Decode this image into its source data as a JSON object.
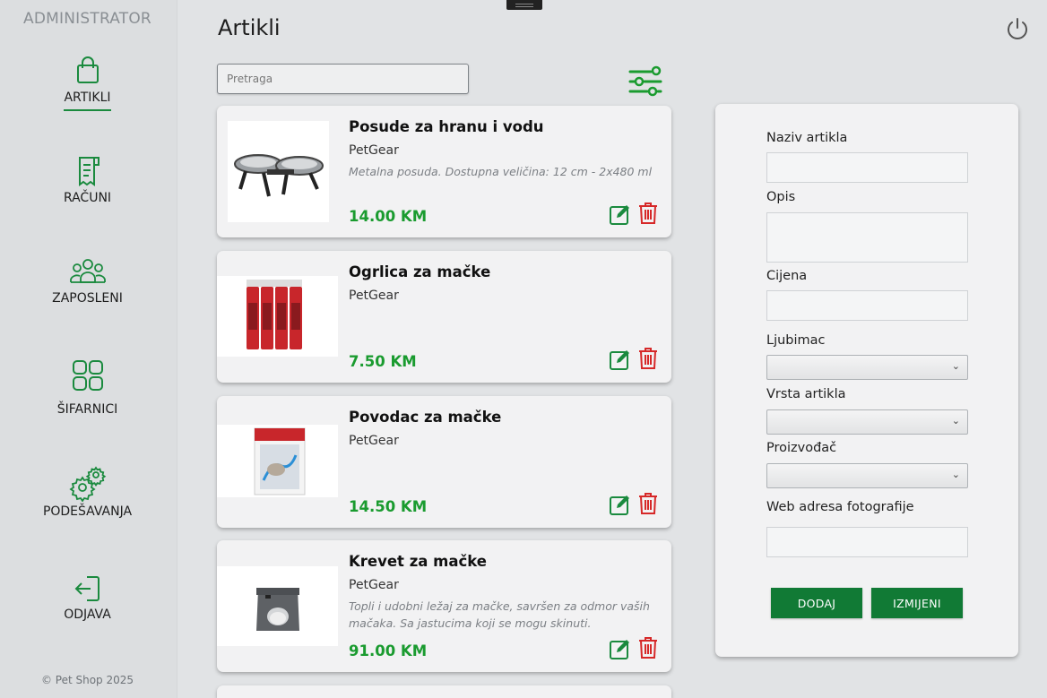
{
  "sidebar": {
    "role": "ADMINISTRATOR",
    "items": [
      {
        "label": "ARTIKLI",
        "icon": "shopping-bag-icon",
        "active": true
      },
      {
        "label": "RAČUNI",
        "icon": "receipt-icon"
      },
      {
        "label": "ZAPOSLENI",
        "icon": "users-icon"
      },
      {
        "label": "ŠIFARNICI",
        "icon": "grid-icon"
      },
      {
        "label": "PODEŠAVANJA",
        "icon": "gears-icon"
      },
      {
        "label": "ODJAVA",
        "icon": "logout-icon"
      }
    ],
    "copyright": "© Pet Shop 2025"
  },
  "header": {
    "title": "Artikli",
    "power_icon": "power-icon"
  },
  "search": {
    "placeholder": "Pretraga",
    "value": ""
  },
  "filter_icon": "filter-sliders-icon",
  "accent_color": "#117a35",
  "price_color": "#1a9b2f",
  "delete_color": "#d62828",
  "products": [
    {
      "name": "Posude za hranu i vodu",
      "brand": "PetGear",
      "description": "Metalna posuda. Dostupna veličina: 12 cm - 2x480 ml",
      "price": "14.00 KM"
    },
    {
      "name": "Ogrlica za mačke",
      "brand": "PetGear",
      "description": "",
      "price": "7.50 KM"
    },
    {
      "name": "Povodac za mačke",
      "brand": "PetGear",
      "description": "",
      "price": "14.50 KM"
    },
    {
      "name": "Krevet za mačke",
      "brand": "PetGear",
      "description": "Topli i udobni ležaj za mačke, savršen za odmor vaših mačaka. Sa jastucima koji se mogu skinuti.",
      "price": "91.00 KM"
    }
  ],
  "form": {
    "name_label": "Naziv artikla",
    "name_value": "",
    "description_label": "Opis",
    "description_value": "",
    "price_label": "Cijena",
    "price_value": "",
    "pet_label": "Ljubimac",
    "pet_selected": "",
    "type_label": "Vrsta artikla",
    "type_selected": "",
    "manufacturer_label": "Proizvođač",
    "manufacturer_selected": "",
    "photo_url_label": "Web adresa fotografije",
    "photo_url_value": "",
    "add_label": "DODAJ",
    "edit_label": "IZMIJENI"
  }
}
